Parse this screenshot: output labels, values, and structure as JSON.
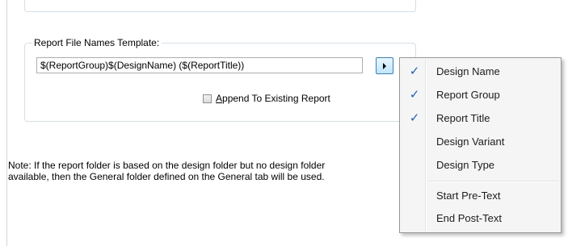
{
  "template_group": {
    "legend": "Report File Names Template:",
    "template_value": "$(ReportGroup)$(DesignName) ($(ReportTitle))",
    "append_checkbox": {
      "label_underlined": "A",
      "label_rest": "ppend To Existing Report",
      "checked": false
    }
  },
  "note": {
    "line1": "Note:  If the report folder is based on the design folder but no design folder",
    "line2": "available, then the General folder defined on the General tab will be used."
  },
  "context_menu": {
    "check_glyph": "✓",
    "items": [
      {
        "label": "Design Name",
        "checked": true
      },
      {
        "label": "Report Group",
        "checked": true
      },
      {
        "label": "Report Title",
        "checked": true
      },
      {
        "label": "Design Variant",
        "checked": false
      },
      {
        "label": "Design Type",
        "checked": false
      },
      {
        "label": "Start Pre-Text",
        "checked": false
      },
      {
        "label": "End Post-Text",
        "checked": false
      }
    ]
  },
  "colors": {
    "check": "#1f5fb4",
    "menu_bg": "#f5f5f5",
    "group_border": "#d5dfe5"
  }
}
